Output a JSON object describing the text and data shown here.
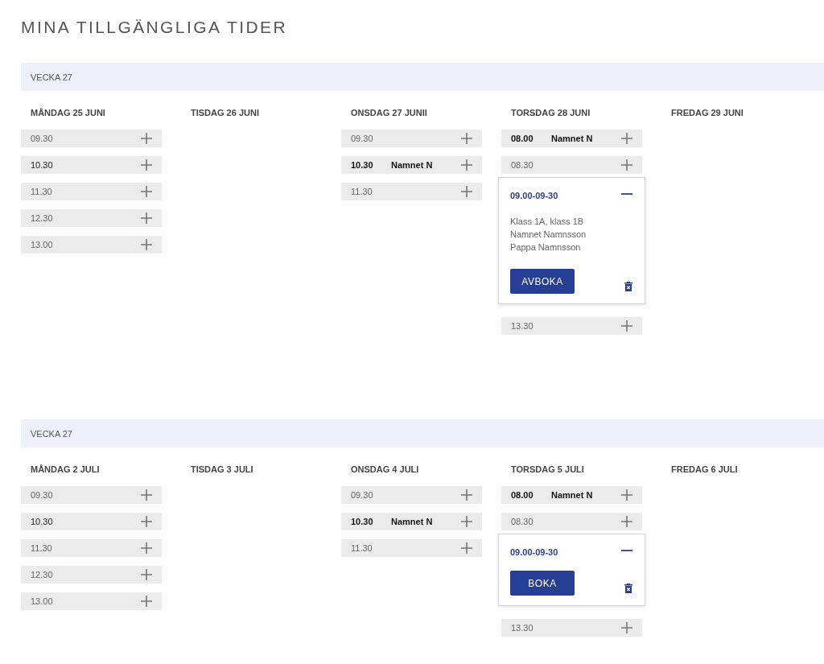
{
  "title": "MINA TILLGÄNGLIGA TIDER",
  "weeks": [
    {
      "label": "VECKA 27",
      "days": [
        {
          "name": "MÅNDAG 25 JUNI",
          "slots": [
            {
              "kind": "slot",
              "time": "09.30",
              "emphasized": false,
              "expanded": false
            },
            {
              "kind": "slot",
              "time": "10.30",
              "emphasized": true,
              "expanded": false
            },
            {
              "kind": "slot",
              "time": "11.30",
              "emphasized": false,
              "expanded": false
            },
            {
              "kind": "slot",
              "time": "12.30",
              "emphasized": false,
              "expanded": false
            },
            {
              "kind": "slot",
              "time": "13.00",
              "emphasized": false,
              "expanded": false
            }
          ]
        },
        {
          "name": "TISDAG 26 JUNI"
        },
        {
          "name": "ONSDAG 27 JUNII",
          "slots": [
            {
              "kind": "slot",
              "time": "09.30",
              "emphasized": false,
              "expanded": false
            },
            {
              "kind": "slot",
              "time": "10.30",
              "emphasized": true,
              "name": "Namnet N",
              "expanded": false
            },
            {
              "kind": "slot",
              "time": "11.30",
              "emphasized": false,
              "expanded": false
            }
          ]
        },
        {
          "name": "TORSDAG 28 JUNI",
          "slots": [
            {
              "kind": "slot",
              "time": "08.00",
              "emphasized": true,
              "name": "Namnet N",
              "expanded": false
            },
            {
              "kind": "slot",
              "time": "08.30",
              "emphasized": false,
              "expanded": false
            },
            {
              "kind": "card",
              "time": "09.00-09-30",
              "expanded": true,
              "details": [
                "Klass 1A, klass 1B",
                "Namnet Namnsson",
                "Pappa Namnsson"
              ],
              "button": "AVBOKA"
            },
            {
              "kind": "slot",
              "time": "13.30",
              "emphasized": false,
              "expanded": false
            }
          ]
        },
        {
          "name": "FREDAG 29 JUNI"
        }
      ]
    },
    {
      "label": "VECKA 27",
      "days": [
        {
          "name": "MÅNDAG 2 JULI",
          "slots": [
            {
              "kind": "slot",
              "time": "09.30",
              "emphasized": false,
              "expanded": false
            },
            {
              "kind": "slot",
              "time": "10.30",
              "emphasized": true,
              "expanded": false
            },
            {
              "kind": "slot",
              "time": "11.30",
              "emphasized": false,
              "expanded": false
            },
            {
              "kind": "slot",
              "time": "12.30",
              "emphasized": false,
              "expanded": false
            },
            {
              "kind": "slot",
              "time": "13.00",
              "emphasized": false,
              "expanded": false
            }
          ]
        },
        {
          "name": "TISDAG 3 JULI"
        },
        {
          "name": "ONSDAG 4 JULI",
          "slots": [
            {
              "kind": "slot",
              "time": "09.30",
              "emphasized": false,
              "expanded": false
            },
            {
              "kind": "slot",
              "time": "10.30",
              "emphasized": true,
              "name": "Namnet N",
              "expanded": false
            },
            {
              "kind": "slot",
              "time": "11.30",
              "emphasized": false,
              "expanded": false
            }
          ]
        },
        {
          "name": "TORSDAG 5 JULI",
          "slots": [
            {
              "kind": "slot",
              "time": "08.00",
              "emphasized": true,
              "name": "Namnet N",
              "expanded": false
            },
            {
              "kind": "slot",
              "time": "08.30",
              "emphasized": false,
              "expanded": false
            },
            {
              "kind": "card",
              "time": "09.00-09-30",
              "expanded": true,
              "button": "BOKA"
            },
            {
              "kind": "slot",
              "time": "13.30",
              "emphasized": false,
              "expanded": false
            }
          ]
        },
        {
          "name": "FREDAG 6 JULI"
        }
      ]
    }
  ]
}
